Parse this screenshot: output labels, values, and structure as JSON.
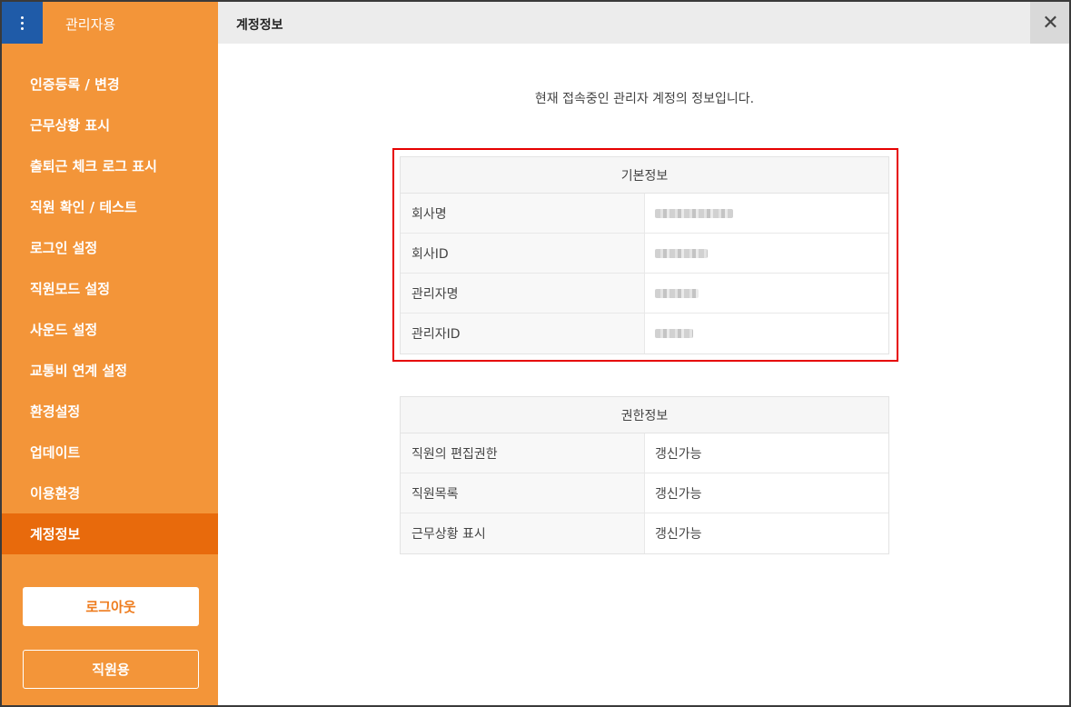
{
  "sidebar": {
    "app_title": "관리자용",
    "menu_icon": "more-vertical-icon",
    "items": [
      {
        "label": "인증등록 / 변경"
      },
      {
        "label": "근무상황 표시"
      },
      {
        "label": "출퇴근 체크 로그 표시"
      },
      {
        "label": "직원 확인 / 테스트"
      },
      {
        "label": "로그인 설정"
      },
      {
        "label": "직원모드 설정"
      },
      {
        "label": "사운드 설정"
      },
      {
        "label": "교통비 연계 설정"
      },
      {
        "label": "환경설정"
      },
      {
        "label": "업데이트"
      },
      {
        "label": "이용환경"
      },
      {
        "label": "계정정보"
      }
    ],
    "active_item": "계정정보",
    "logout_label": "로그아웃",
    "staff_label": "직원용"
  },
  "header": {
    "title": "계정정보",
    "close_icon": "close-icon",
    "close_glyph": "✕"
  },
  "main": {
    "intro": "현재 접속중인 관리자 계정의 정보입니다.",
    "basic_info": {
      "title": "기본정보",
      "rows": [
        {
          "key": "회사명",
          "value": ""
        },
        {
          "key": "회사ID",
          "value": ""
        },
        {
          "key": "관리자명",
          "value": ""
        },
        {
          "key": "관리자ID",
          "value": ""
        }
      ]
    },
    "permissions": {
      "title": "권한정보",
      "rows": [
        {
          "key": "직원의 편집권한",
          "value": "갱신가능"
        },
        {
          "key": "직원목록",
          "value": "갱신가능"
        },
        {
          "key": "근무상황 표시",
          "value": "갱신가능"
        }
      ]
    }
  },
  "colors": {
    "sidebar_bg": "#f39539",
    "sidebar_active": "#e86a0c",
    "menu_button": "#1f5ba8",
    "highlight_border": "#e60000"
  }
}
